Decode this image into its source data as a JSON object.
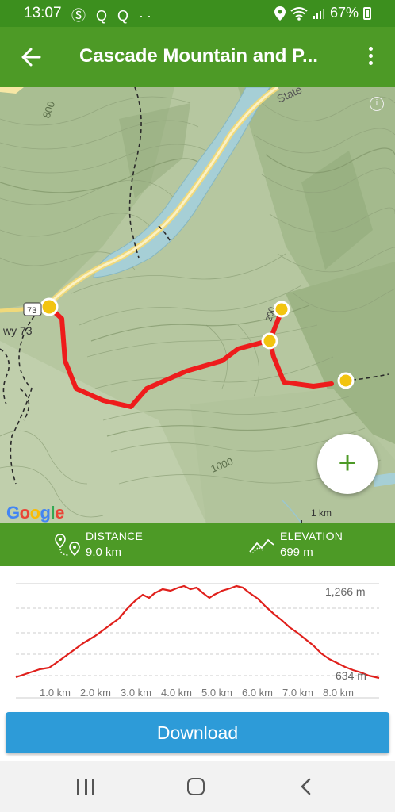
{
  "status_bar": {
    "time": "13:07",
    "left_icons": "Ⓢ Q Q ··",
    "battery": "67%"
  },
  "app_bar": {
    "title": "Cascade Mountain and P..."
  },
  "map": {
    "labels": {
      "state_road": "State",
      "contour_800": "800",
      "contour_1000": "1000",
      "road_sign": "73",
      "hwy": "wy 73",
      "trail_marker": "200"
    },
    "attribution": "Google",
    "scale": "1 km",
    "zoom_button": "+"
  },
  "stats": {
    "distance_label": "DISTANCE",
    "distance_value": "9.0 km",
    "elevation_label": "ELEVATION",
    "elevation_value": "699 m"
  },
  "elevation_chart": {
    "max_label": "1,266 m",
    "min_label": "634 m",
    "km_ticks": [
      "1.0 km",
      "2.0 km",
      "3.0 km",
      "4.0 km",
      "5.0 km",
      "6.0 km",
      "7.0 km",
      "8.0 km"
    ],
    "line_color": "#e0201c"
  },
  "download": {
    "label": "Download"
  },
  "colors": {
    "brand_green": "#4d9a26",
    "status_green": "#3c8f1e",
    "trail_red": "#ee1c1c",
    "download_blue": "#2d9bd8",
    "waypoint_yellow": "#f2c40f"
  }
}
